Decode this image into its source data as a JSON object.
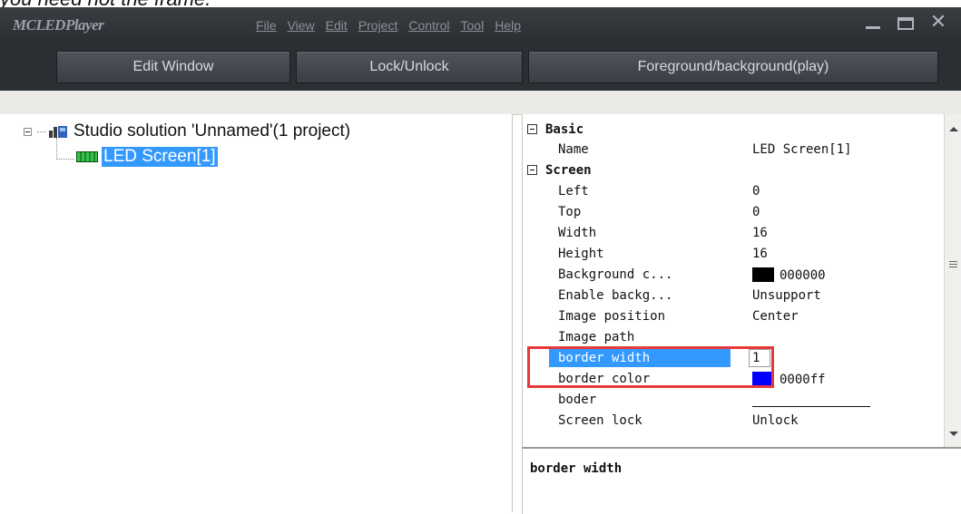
{
  "caption_partial": "you need not the frame.",
  "window": {
    "app_title": "MCLEDPlayer",
    "menu": [
      "File",
      "View",
      "Edit",
      "Project",
      "Control",
      "Tool",
      "Help"
    ],
    "controls": {
      "minimize": "minimize-icon",
      "maximize": "maximize-icon",
      "close": "✕"
    }
  },
  "toolbar": {
    "buttons": [
      "Edit Window",
      "Lock/Unlock",
      "Foreground/background(play)"
    ]
  },
  "tree": {
    "root_label": "Studio solution 'Unnamed'(1 project)",
    "child_label": "LED Screen[1]"
  },
  "properties": {
    "categories": {
      "basic": "Basic",
      "screen": "Screen"
    },
    "rows": [
      {
        "key": "Name",
        "value": "LED Screen[1]"
      },
      {
        "key": "Left",
        "value": "0"
      },
      {
        "key": "Top",
        "value": "0"
      },
      {
        "key": "Width",
        "value": "16"
      },
      {
        "key": "Height",
        "value": "16"
      },
      {
        "key": "Background c...",
        "value": "000000",
        "swatch": "#000000"
      },
      {
        "key": "Enable backg...",
        "value": "Unsupport"
      },
      {
        "key": "Image position",
        "value": "Center"
      },
      {
        "key": "Image path",
        "value": ""
      },
      {
        "key": "border width",
        "value": "1",
        "selected": true
      },
      {
        "key": "border color",
        "value": "0000ff",
        "swatch": "#0000ff"
      },
      {
        "key": "boder",
        "value": ""
      },
      {
        "key": "Screen lock",
        "value": "Unlock"
      }
    ]
  },
  "description": {
    "title": "border width"
  },
  "colors": {
    "selection": "#3399ff",
    "highlight": "#e63a3a",
    "titlebar": "#2b2e33"
  }
}
